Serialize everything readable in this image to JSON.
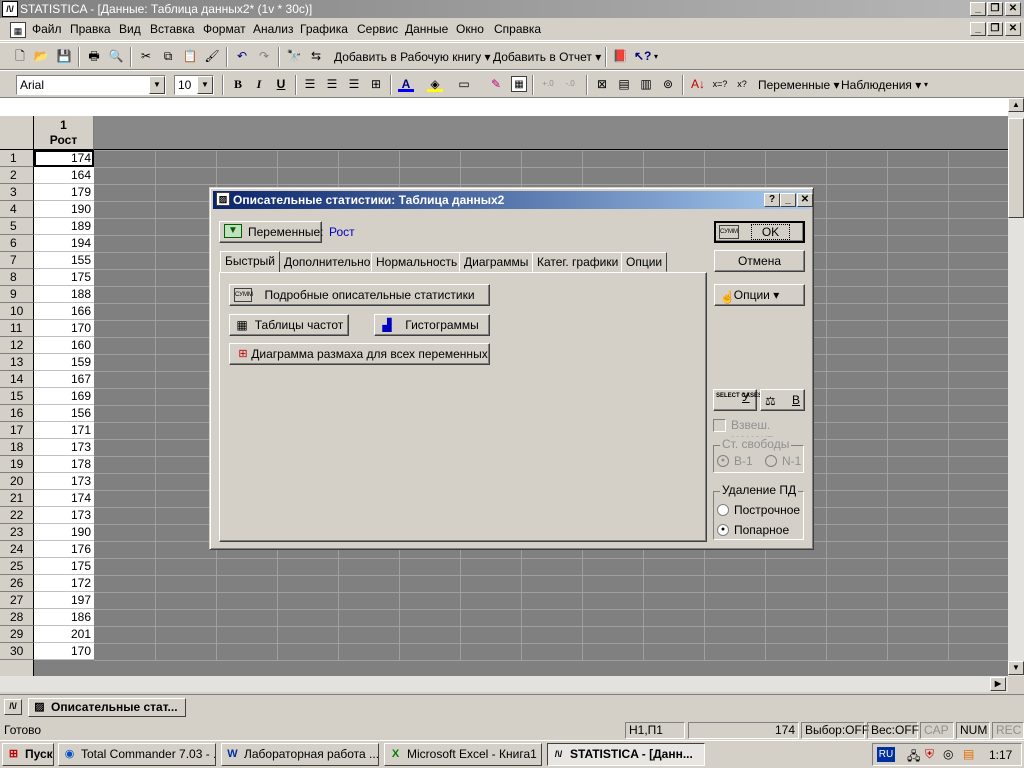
{
  "app": {
    "title": "STATISTICA - [Данные: Таблица данных2* (1v * 30c)]",
    "window_controls": [
      "_",
      "❐",
      "✕"
    ]
  },
  "menu": [
    "Файл",
    "Правка",
    "Вид",
    "Вставка",
    "Формат",
    "Анализ",
    "Графика",
    "Сервис",
    "Данные",
    "Окно",
    "Справка"
  ],
  "toolbar1": {
    "add_workbook": "Добавить в Рабочую книгу",
    "add_report": "Добавить в Отчет"
  },
  "toolbar2": {
    "font": "Arial",
    "size": "10",
    "bold": "B",
    "italic": "I",
    "underline": "U",
    "variables": "Переменные",
    "cases": "Наблюдения"
  },
  "sheet": {
    "col_number": "1",
    "col_name": "Рост",
    "rows": [
      {
        "n": "1",
        "v": "174"
      },
      {
        "n": "2",
        "v": "164"
      },
      {
        "n": "3",
        "v": "179"
      },
      {
        "n": "4",
        "v": "190"
      },
      {
        "n": "5",
        "v": "189"
      },
      {
        "n": "6",
        "v": "194"
      },
      {
        "n": "7",
        "v": "155"
      },
      {
        "n": "8",
        "v": "175"
      },
      {
        "n": "9",
        "v": "188"
      },
      {
        "n": "10",
        "v": "166"
      },
      {
        "n": "11",
        "v": "170"
      },
      {
        "n": "12",
        "v": "160"
      },
      {
        "n": "13",
        "v": "159"
      },
      {
        "n": "14",
        "v": "167"
      },
      {
        "n": "15",
        "v": "169"
      },
      {
        "n": "16",
        "v": "156"
      },
      {
        "n": "17",
        "v": "171"
      },
      {
        "n": "18",
        "v": "173"
      },
      {
        "n": "19",
        "v": "178"
      },
      {
        "n": "20",
        "v": "173"
      },
      {
        "n": "21",
        "v": "174"
      },
      {
        "n": "22",
        "v": "173"
      },
      {
        "n": "23",
        "v": "190"
      },
      {
        "n": "24",
        "v": "176"
      },
      {
        "n": "25",
        "v": "175"
      },
      {
        "n": "26",
        "v": "172"
      },
      {
        "n": "27",
        "v": "197"
      },
      {
        "n": "28",
        "v": "186"
      },
      {
        "n": "29",
        "v": "201"
      },
      {
        "n": "30",
        "v": "170"
      }
    ]
  },
  "dialog": {
    "title": "Описательные статистики: Таблица данных2",
    "variables_button": "Переменные:",
    "variables_value": "Рост",
    "tabs": [
      "Быстрый",
      "Дополнительно",
      "Нормальность",
      "Диаграммы",
      "Катег. графики",
      "Опции"
    ],
    "btn_detailed": "Подробные описательные статистики",
    "btn_freq": "Таблицы частот",
    "btn_hist": "Гистограммы",
    "btn_boxplot": "Диаграмма размаха для всех переменных",
    "ok": "OK",
    "cancel": "Отмена",
    "options": "Опции",
    "select_cases": "SELECT CASES",
    "select_u": "У",
    "weight_b": "В",
    "weighted_moments": "Взвеш. момент",
    "df_group": "Ст. свободы",
    "df_n1": "В-1",
    "df_nm1": "N-1",
    "md_group": "Удаление ПД",
    "md_casewise": "Построчное",
    "md_pairwise": "Попарное",
    "sum_icon_label": "СУММ"
  },
  "mdi_tab": "Описательные стат...",
  "status": {
    "ready": "Готово",
    "cell_ref": "Н1,П1",
    "value": "174",
    "sel": "Выбор:OFF",
    "weight": "Вес:OFF",
    "cap": "CAP",
    "num": "NUM",
    "rec": "REC"
  },
  "taskbar": {
    "start": "Пуск",
    "items": [
      "Total Commander 7.03 - ...",
      "Лабораторная работа ...",
      "Microsoft Excel - Книга1",
      "STATISTICA - [Данн..."
    ],
    "lang": "RU",
    "clock": "1:17"
  }
}
